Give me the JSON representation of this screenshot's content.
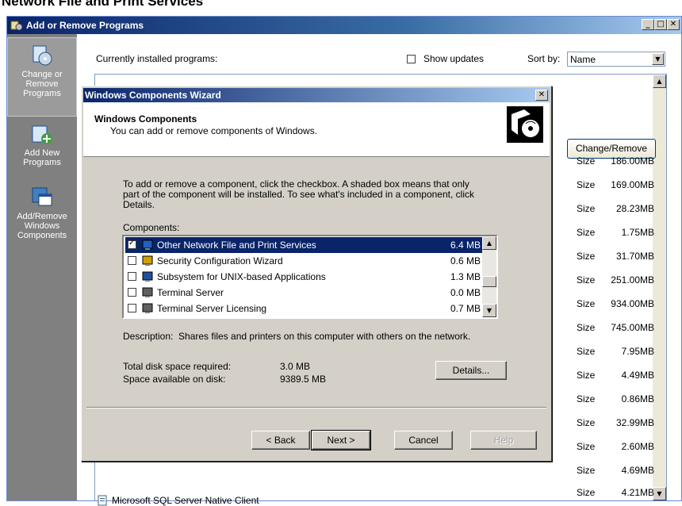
{
  "page_heading": "Network File and Print Services",
  "arp": {
    "title": "Add or Remove Programs",
    "window_buttons": [
      "_",
      "□",
      "✕"
    ],
    "sidebar": [
      {
        "label": "Change or Remove Programs",
        "icon": "change-remove-programs-icon",
        "active": true
      },
      {
        "label": "Add New Programs",
        "icon": "add-new-programs-icon",
        "active": false
      },
      {
        "label": "Add/Remove Windows Components",
        "icon": "windows-components-icon",
        "active": false
      }
    ],
    "currently_installed_label": "Currently installed programs:",
    "show_updates_label": "Show updates",
    "show_updates_checked": false,
    "sort_by_label": "Sort by:",
    "sort_by_value": "Name",
    "change_remove_button": "Change/Remove",
    "size_label": "Size",
    "sizes": [
      "186.00MB",
      "169.00MB",
      "28.23MB",
      "1.75MB",
      "31.70MB",
      "251.00MB",
      "934.00MB",
      "745.00MB",
      "7.95MB",
      "4.49MB",
      "0.86MB",
      "32.99MB",
      "2.60MB",
      "4.69MB",
      "4.21MB"
    ],
    "visible_program": "Microsoft SQL Server Native Client"
  },
  "wizard": {
    "title": "Windows Components Wizard",
    "header_title": "Windows Components",
    "header_subtitle": "You can add or remove components of Windows.",
    "instructions_line1": "To add or remove a component, click the checkbox.  A shaded box means that only",
    "instructions_line2": "part of the component will be installed.  To see what's included in a component, click",
    "instructions_line3": "Details.",
    "components_label": "Components:",
    "components": [
      {
        "name": "Other Network File and Print Services",
        "size": "6.4 MB",
        "checked": true,
        "selected": true,
        "icon": "network-services-icon"
      },
      {
        "name": "Security Configuration Wizard",
        "size": "0.6 MB",
        "checked": false,
        "selected": false,
        "icon": "security-wizard-icon"
      },
      {
        "name": "Subsystem for UNIX-based Applications",
        "size": "1.3 MB",
        "checked": false,
        "selected": false,
        "icon": "unix-subsystem-icon"
      },
      {
        "name": "Terminal Server",
        "size": "0.0 MB",
        "checked": false,
        "selected": false,
        "icon": "terminal-server-icon"
      },
      {
        "name": "Terminal Server Licensing",
        "size": "0.7 MB",
        "checked": false,
        "selected": false,
        "icon": "terminal-licensing-icon"
      }
    ],
    "description_label": "Description:",
    "description_text": "Shares files and printers on this computer with others on the network.",
    "disk_required_label": "Total disk space required:",
    "disk_required_value": "3.0 MB",
    "disk_available_label": "Space available on disk:",
    "disk_available_value": "9389.5 MB",
    "details_button": "Details...",
    "back_button": "< Back",
    "next_button": "Next >",
    "cancel_button": "Cancel",
    "help_button": "Help"
  }
}
